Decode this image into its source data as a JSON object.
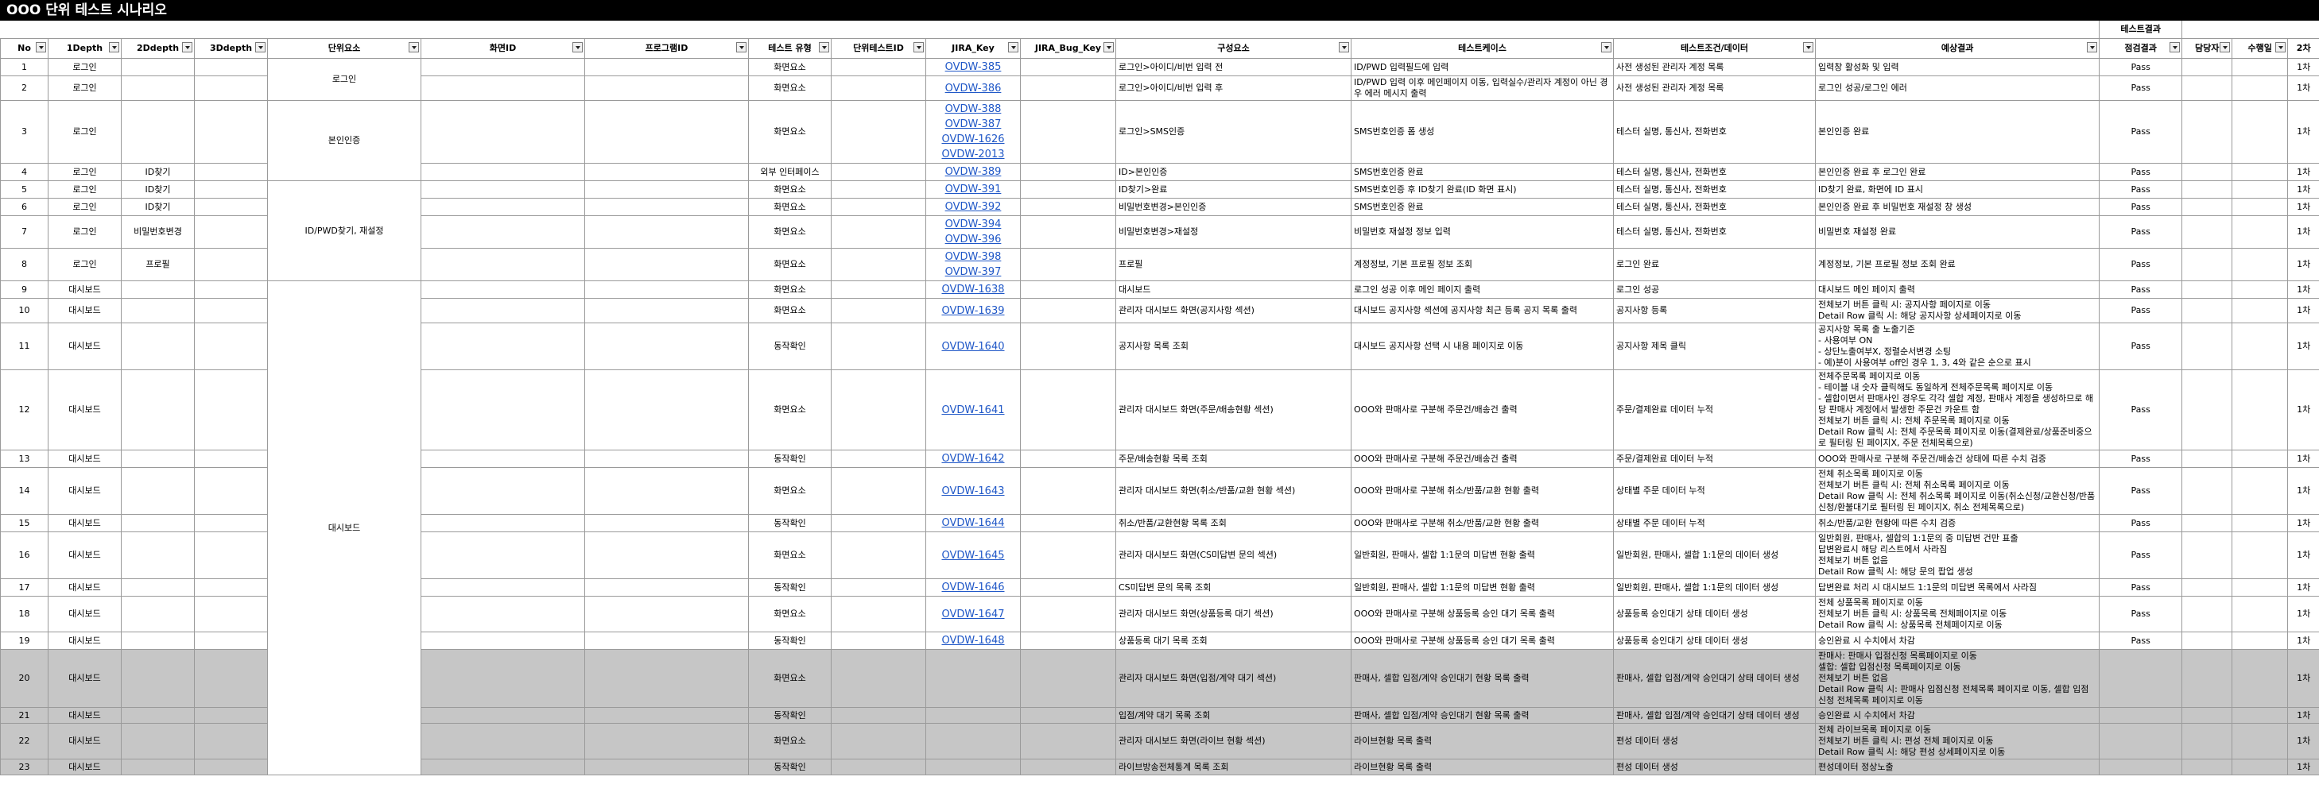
{
  "title": "OOO 단위 테스트 시나리오",
  "header_group": "테스트결과",
  "columns": [
    "No",
    "1Depth",
    "2Ddepth",
    "3Ddepth",
    "단위요소",
    "화면ID",
    "프로그램ID",
    "테스트 유형",
    "단위테스트ID",
    "JIRA_Key",
    "JIRA_Bug_Key",
    "구성요소",
    "테스트케이스",
    "테스트조건/데이터",
    "예상결과",
    "점검결과",
    "담당자",
    "수행일",
    "2차"
  ],
  "merged_unit": [
    "로그인",
    "본인인증",
    "ID/PWD찾기, 재설정",
    "대시보드"
  ],
  "rows": [
    {
      "no": "1",
      "d1": "로그인",
      "d2": "",
      "type": "화면요소",
      "jira": [
        "OVDW-385"
      ],
      "comp": "로그인>아이디/비번 입력 전",
      "case": "ID/PWD 입력필드에 입력",
      "cond": "사전 생성된 관리자 계정 목록",
      "exp": "입력창 활성화 및 입력",
      "res": "Pass",
      "second": "1차"
    },
    {
      "no": "2",
      "d1": "로그인",
      "d2": "",
      "type": "화면요소",
      "jira": [
        "OVDW-386"
      ],
      "comp": "로그인>아이디/비번 입력 후",
      "case": "ID/PWD 입력 이후 메인페이지 이동, 입력실수/관리자 계정이 아닌 경우 에러 메시지 출력",
      "cond": "사전 생성된 관리자 계정 목록",
      "exp": "로그인 성공/로그인 에러",
      "res": "Pass",
      "second": "1차"
    },
    {
      "no": "3",
      "d1": "로그인",
      "d2": "",
      "type": "화면요소",
      "jira": [
        "OVDW-388",
        "OVDW-387",
        "OVDW-1626",
        "OVDW-2013"
      ],
      "comp": "로그인>SMS인증",
      "case": "SMS번호인증 폼 생성",
      "cond": "테스터 실명, 통신사, 전화번호",
      "exp": "본인인증 완료",
      "res": "Pass",
      "second": "1차"
    },
    {
      "no": "4",
      "d1": "로그인",
      "d2": "ID찾기",
      "type": "외부 인터페이스",
      "jira": [
        "OVDW-389"
      ],
      "comp": "ID>본인인증",
      "case": "SMS번호인증 완료",
      "cond": "테스터 실명, 통신사, 전화번호",
      "exp": "본인인증 완료 후 로그인 완료",
      "res": "Pass",
      "second": "1차"
    },
    {
      "no": "5",
      "d1": "로그인",
      "d2": "ID찾기",
      "type": "화면요소",
      "jira": [
        "OVDW-391"
      ],
      "comp": "ID찾기>완료",
      "case": "SMS번호인증 후 ID찾기 완료(ID 화면 표시)",
      "cond": "테스터 실명, 통신사, 전화번호",
      "exp": "ID찾기 완료, 화면에 ID 표시",
      "res": "Pass",
      "second": "1차"
    },
    {
      "no": "6",
      "d1": "로그인",
      "d2": "ID찾기",
      "type": "화면요소",
      "jira": [
        "OVDW-392"
      ],
      "comp": "비밀번호변경>본인인증",
      "case": "SMS번호인증 완료",
      "cond": "테스터 실명, 통신사, 전화번호",
      "exp": "본인인증 완료 후 비밀번호 재설정 창 생성",
      "res": "Pass",
      "second": "1차"
    },
    {
      "no": "7",
      "d1": "로그인",
      "d2": "비밀번호변경",
      "type": "화면요소",
      "jira": [
        "OVDW-394",
        "OVDW-396"
      ],
      "comp": "비밀번호변경>재설정",
      "case": "비밀번호 재설정 정보 입력",
      "cond": "테스터 실명, 통신사, 전화번호",
      "exp": "비밀번호 재설정 완료",
      "res": "Pass",
      "second": "1차"
    },
    {
      "no": "8",
      "d1": "로그인",
      "d2": "프로필",
      "type": "화면요소",
      "jira": [
        "OVDW-398",
        "OVDW-397"
      ],
      "comp": "프로필",
      "case": "계정정보, 기본 프로필 정보 조회",
      "cond": "로그인 완료",
      "exp": "계정정보, 기본 프로필 정보 조회 완료",
      "res": "Pass",
      "second": "1차"
    },
    {
      "no": "9",
      "d1": "대시보드",
      "d2": "",
      "type": "화면요소",
      "jira": [
        "OVDW-1638"
      ],
      "comp": "대시보드",
      "case": "로그인 성공 이후 메인 페이지 출력",
      "cond": "로그인 성공",
      "exp": "대시보드 메인 페이지 출력",
      "res": "Pass",
      "second": "1차"
    },
    {
      "no": "10",
      "d1": "대시보드",
      "d2": "",
      "type": "화면요소",
      "jira": [
        "OVDW-1639"
      ],
      "comp": "관리자 대시보드 화면(공지사항 섹션)",
      "case": "대시보드 공지사항 섹션에 공지사항 최근 등록 공지 목록 출력",
      "cond": "공지사항 등록",
      "exp": "전체보기 버튼 클릭 시: 공지사항 페이지로 이동\nDetail Row 클릭 시: 해당 공지사항 상세페이지로 이동",
      "res": "Pass",
      "second": "1차"
    },
    {
      "no": "11",
      "d1": "대시보드",
      "d2": "",
      "type": "동작확인",
      "jira": [
        "OVDW-1640"
      ],
      "comp": "공지사항 목록 조회",
      "case": "대시보드 공지사항 선택 시 내용 페이지로 이동",
      "cond": "공지사항 제목 클릭",
      "exp": "공지사항 목록 출 노출기준\n- 사용여부 ON\n- 상단노출여부X, 정렬순서변경 소팅\n- 예)분이 사용여부 off인 경우 1, 3, 4와 같은 순으로 표시",
      "res": "Pass",
      "second": "1차"
    },
    {
      "no": "12",
      "d1": "대시보드",
      "d2": "",
      "type": "화면요소",
      "jira": [
        "OVDW-1641"
      ],
      "comp": "관리자 대시보드 화면(주문/배송현황 섹션)",
      "case": "OOO와 판매사로 구분해 주문건/배송건 출력",
      "cond": "주문/결제완료 데이터 누적",
      "exp": "전체주문목록 페이지로 이동\n- 테이블 내 숫자 클릭해도 동일하게 전체주문목록 페이지로 이동\n- 셀합이면서 판매사인 경우도 각각 셀합 계정, 판매사 계정을 생성하므로 해당 판매사 계정에서 발생한 주문건 카운트 함\n전체보기 버튼 클릭 시: 전체 주문목록 페이지로 이동\nDetail Row 클릭 시: 전체 주문목록 페이지로 이동(결제완료/상품준비중으로 필터링 된 페이지X, 주문 전체목록으로)",
      "res": "Pass",
      "second": "1차"
    },
    {
      "no": "13",
      "d1": "대시보드",
      "d2": "",
      "type": "동작확인",
      "jira": [
        "OVDW-1642"
      ],
      "comp": "주문/배송현황 목록 조회",
      "case": "OOO와 판매사로 구분해 주문건/배송건 출력",
      "cond": "주문/결제완료 데이터 누적",
      "exp": "OOO와 판매사로 구분해 주문건/배송건 상태에 따른 수치 검증",
      "res": "Pass",
      "second": "1차"
    },
    {
      "no": "14",
      "d1": "대시보드",
      "d2": "",
      "type": "화면요소",
      "jira": [
        "OVDW-1643"
      ],
      "comp": "관리자 대시보드 화면(취소/반품/교환 현황 섹션)",
      "case": "OOO와 판매사로 구분해 취소/반품/교환 현황 출력",
      "cond": "상태별 주문 데이터 누적",
      "exp": "전체 취소목록 페이지로 이동\n전체보기 버튼 클릭 시: 전체 취소목록 페이지로 이동\nDetail Row 클릭 시: 전체 취소목록 페이지로 이동(취소신청/교환신청/반품신청/환불대기로 필터링 된 페이지X, 취소 전체목록으로)",
      "res": "Pass",
      "second": "1차"
    },
    {
      "no": "15",
      "d1": "대시보드",
      "d2": "",
      "type": "동작확인",
      "jira": [
        "OVDW-1644"
      ],
      "comp": "취소/반품/교환현황 목록 조회",
      "case": "OOO와 판매사로 구분해 취소/반품/교환 현황 출력",
      "cond": "상태별 주문 데이터 누적",
      "exp": "취소/반품/교환 현황에 따른 수치 검증",
      "res": "Pass",
      "second": "1차"
    },
    {
      "no": "16",
      "d1": "대시보드",
      "d2": "",
      "type": "화면요소",
      "jira": [
        "OVDW-1645"
      ],
      "comp": "관리자 대시보드 화면(CS미답변 문의 섹션)",
      "case": "일반회원, 판매사, 셀합 1:1문의 미답변 현황 출력",
      "cond": "일반회원, 판매사, 셀합 1:1문의 데이터 생성",
      "exp": "일반회원, 판매사, 셀합의 1:1문의 중 미답변 건만 표출\n답변완료시 해당 리스트에서 사라짐\n전체보기 버튼 없음\nDetail Row 클릭 시: 해당 문의 팝업 생성",
      "res": "Pass",
      "second": "1차"
    },
    {
      "no": "17",
      "d1": "대시보드",
      "d2": "",
      "type": "동작확인",
      "jira": [
        "OVDW-1646"
      ],
      "comp": "CS미답변 문의 목록 조회",
      "case": "일반회원, 판매사, 셀합 1:1문의 미답변 현황 출력",
      "cond": "일반회원, 판매사, 셀합 1:1문의 데이터 생성",
      "exp": "답변완료 처리 시 대시보드 1:1문의 미답변 목록에서 사라짐",
      "res": "Pass",
      "second": "1차"
    },
    {
      "no": "18",
      "d1": "대시보드",
      "d2": "",
      "type": "화면요소",
      "jira": [
        "OVDW-1647"
      ],
      "comp": "관리자 대시보드 화면(상품등록 대기 섹션)",
      "case": "OOO와 판매사로 구분해 상품등록 승인 대기 목록 출력",
      "cond": "상품등록 승인대기 상태 데이터 생성",
      "exp": "전체 상품목록 페이지로 이동\n전체보기 버튼 클릭 시: 상품목록 전체페이지로 이동\nDetail Row 클릭 시: 상품목록 전체페이지로 이동",
      "res": "Pass",
      "second": "1차"
    },
    {
      "no": "19",
      "d1": "대시보드",
      "d2": "",
      "type": "동작확인",
      "jira": [
        "OVDW-1648"
      ],
      "comp": "상품등록 대기 목록 조회",
      "case": "OOO와 판매사로 구분해 상품등록 승인 대기 목록 출력",
      "cond": "상품등록 승인대기 상태 데이터 생성",
      "exp": "승인완료 시 수치에서 차감",
      "res": "Pass",
      "second": "1차"
    },
    {
      "no": "20",
      "d1": "대시보드",
      "d2": "",
      "type": "화면요소",
      "jira": [],
      "comp": "관리자 대시보드 화면(입점/계약 대기 섹션)",
      "case": "판매사, 셀합 입점/계약 승인대기 현황 목록 출력",
      "cond": "판매사, 셀합 입점/계약 승인대기 상태 데이터 생성",
      "exp": "판매사: 판매사 입점신청 목록페이지로 이동\n셀합: 셀합 입점신청 목록페이지로 이동\n전체보기 버튼 없음\nDetail Row 클릭 시: 판매사 입점신청 전체목록 페이지로 이동, 셀합 입점신청 전체목록 페이지로 이동",
      "res": "",
      "second": "1차"
    },
    {
      "no": "21",
      "d1": "대시보드",
      "d2": "",
      "type": "동작확인",
      "jira": [],
      "comp": "입점/계약 대기 목록 조회",
      "case": "판매사, 셀합 입점/계약 승인대기 현황 목록 출력",
      "cond": "판매사, 셀합 입점/계약 승인대기 상태 데이터 생성",
      "exp": "승인완료 시 수치에서 차감",
      "res": "",
      "second": "1차"
    },
    {
      "no": "22",
      "d1": "대시보드",
      "d2": "",
      "type": "화면요소",
      "jira": [],
      "comp": "관리자 대시보드 화면(라이브 현황 섹션)",
      "case": "라이브현황 목록 출력",
      "cond": "편성 데이터 생성",
      "exp": "전체 라이브목록 페이지로 이동\n전체보기 버튼 클릭 시: 편성 전체 페이지로 이동\nDetail Row 클릭 시: 해당 편성 상세페이지로 이동",
      "res": "",
      "second": "1차"
    },
    {
      "no": "23",
      "d1": "대시보드",
      "d2": "",
      "type": "동작확인",
      "jira": [],
      "comp": "라이브방송전체통계 목록 조회",
      "case": "라이브현황 목록 출력",
      "cond": "편성 데이터 생성",
      "exp": "편성데이터 정상노출",
      "res": "",
      "second": "1차"
    }
  ]
}
